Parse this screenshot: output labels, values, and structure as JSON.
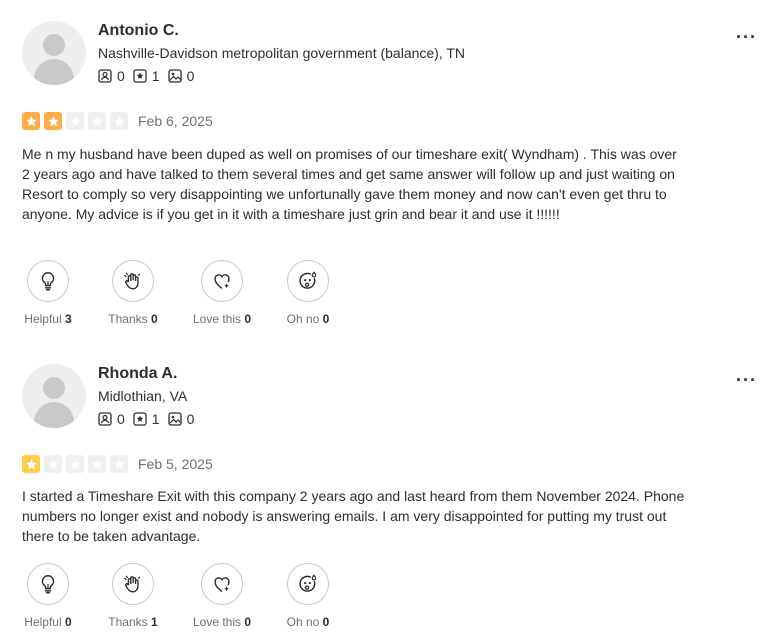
{
  "reviews": [
    {
      "name": "Antonio C.",
      "location": "Nashville-Davidson metropolitan government (balance), TN",
      "stats": {
        "friends": "0",
        "reviews": "1",
        "photos": "0"
      },
      "rating": 2,
      "rating_color": "#ffad48",
      "date": "Feb 6, 2025",
      "text": "Me n my husband have been duped as well on promises of our timeshare exit( Wyndham) . This was over 2 years ago and have talked to them several times and get same answer will follow up and just waiting on Resort to comply so very disappointing we unfortunally gave them money and now can't even get thru to anyone. My advice is if you get in it with a timeshare just grin and bear it and use it !!!!!!",
      "reactions": {
        "helpful": {
          "label": "Helpful",
          "count": "3"
        },
        "thanks": {
          "label": "Thanks",
          "count": "0"
        },
        "love": {
          "label": "Love this",
          "count": "0"
        },
        "ohno": {
          "label": "Oh no",
          "count": "0"
        }
      }
    },
    {
      "name": "Rhonda A.",
      "location": "Midlothian, VA",
      "stats": {
        "friends": "0",
        "reviews": "1",
        "photos": "0"
      },
      "rating": 1,
      "rating_color": "#ffcc4b",
      "date": "Feb 5, 2025",
      "text": "I started a Timeshare Exit with this company 2 years ago and last heard from them November 2024. Phone numbers no longer exist and nobody is answering emails. I am very disappointed for putting my trust out there to be taken advantage.",
      "reactions": {
        "helpful": {
          "label": "Helpful",
          "count": "0"
        },
        "thanks": {
          "label": "Thanks",
          "count": "1"
        },
        "love": {
          "label": "Love this",
          "count": "0"
        },
        "ohno": {
          "label": "Oh no",
          "count": "0"
        }
      }
    }
  ],
  "colors": {
    "empty_star": "#f0f0f0",
    "text": "#2d2e2f",
    "muted": "#6e7072"
  },
  "more_label": "···"
}
